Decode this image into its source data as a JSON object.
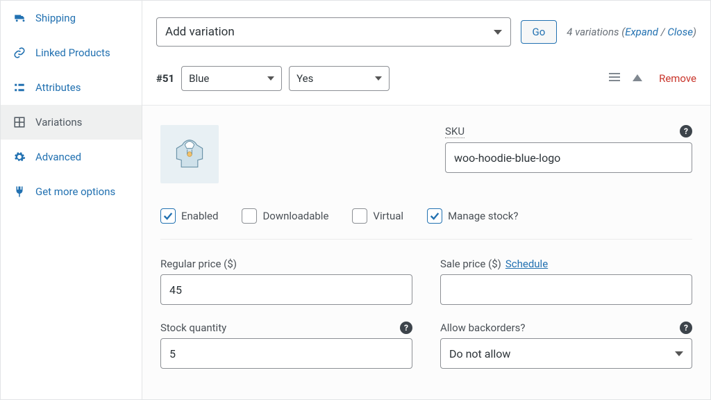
{
  "sidebar": {
    "items": [
      {
        "label": "Shipping"
      },
      {
        "label": "Linked Products"
      },
      {
        "label": "Attributes"
      },
      {
        "label": "Variations"
      },
      {
        "label": "Advanced"
      },
      {
        "label": "Get more options"
      }
    ]
  },
  "toolbar": {
    "add_variation": "Add variation",
    "go": "Go",
    "info_count": "4 variations (",
    "expand": "Expand",
    "sep": " / ",
    "close": "Close",
    "info_end": ")"
  },
  "variation": {
    "id": "#51",
    "attr1": "Blue",
    "attr2": "Yes",
    "remove": "Remove"
  },
  "fields": {
    "sku_label": "SKU",
    "sku_value": "woo-hoodie-blue-logo",
    "enabled": "Enabled",
    "downloadable": "Downloadable",
    "virtual": "Virtual",
    "manage_stock": "Manage stock?",
    "regular_price_label": "Regular price ($)",
    "regular_price_value": "45",
    "sale_price_label": "Sale price ($) ",
    "schedule": "Schedule",
    "sale_price_value": "",
    "stock_qty_label": "Stock quantity",
    "stock_qty_value": "5",
    "backorders_label": "Allow backorders?",
    "backorders_value": "Do not allow"
  }
}
